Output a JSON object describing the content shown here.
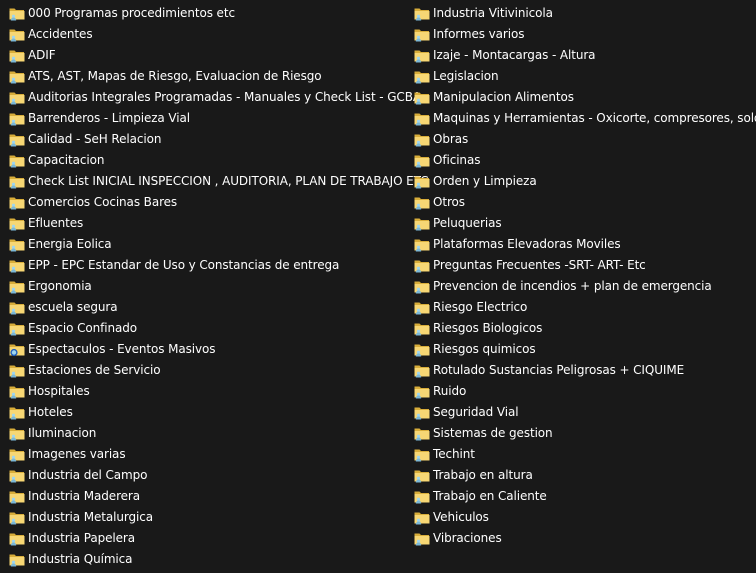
{
  "folder_icon": "folder-icon",
  "colors": {
    "background": "#191919",
    "text": "#ffffff",
    "folder": "#f7d774",
    "folder_dark": "#d8ad3a",
    "user_badge": "#9fd6ee"
  },
  "left_items": [
    {
      "label": "000 Programas procedimientos etc",
      "icon": "shared-folder-icon"
    },
    {
      "label": "Accidentes",
      "icon": "shared-folder-icon"
    },
    {
      "label": "ADIF",
      "icon": "shared-folder-icon"
    },
    {
      "label": "ATS, AST, Mapas de Riesgo, Evaluacion de Riesgo",
      "icon": "shared-folder-icon"
    },
    {
      "label": "Auditorias Integrales Programadas  - Manuales y Check List - GCBA",
      "icon": "shared-folder-icon"
    },
    {
      "label": "Barrenderos - Limpieza Vial",
      "icon": "shared-folder-icon"
    },
    {
      "label": "Calidad - SeH Relacion",
      "icon": "shared-folder-icon"
    },
    {
      "label": "Capacitacion",
      "icon": "shared-folder-icon"
    },
    {
      "label": "Check List INICIAL INSPECCION , AUDITORIA, PLAN DE TRABAJO  ETC",
      "icon": "shared-folder-icon"
    },
    {
      "label": "Comercios Cocinas Bares",
      "icon": "shared-folder-icon"
    },
    {
      "label": "Efluentes",
      "icon": "shared-folder-icon"
    },
    {
      "label": "Energia Eolica",
      "icon": "shared-folder-icon"
    },
    {
      "label": "EPP - EPC Estandar de Uso y Constancias de entrega",
      "icon": "shared-folder-icon"
    },
    {
      "label": "Ergonomia",
      "icon": "shared-folder-icon"
    },
    {
      "label": "escuela segura",
      "icon": "shared-folder-icon"
    },
    {
      "label": "Espacio Confinado",
      "icon": "shared-folder-icon"
    },
    {
      "label": "Espectaculos - Eventos Masivos",
      "icon": "sync-icon"
    },
    {
      "label": "Estaciones de Servicio",
      "icon": "shared-folder-icon"
    },
    {
      "label": "Hospitales",
      "icon": "shared-folder-icon"
    },
    {
      "label": "Hoteles",
      "icon": "shared-folder-icon"
    },
    {
      "label": "Iluminacion",
      "icon": "shared-folder-icon"
    },
    {
      "label": "Imagenes varias",
      "icon": "shared-folder-icon"
    },
    {
      "label": "Industria del Campo",
      "icon": "shared-folder-icon"
    },
    {
      "label": "Industria Maderera",
      "icon": "shared-folder-icon"
    },
    {
      "label": "Industria Metalurgica",
      "icon": "shared-folder-icon"
    },
    {
      "label": "Industria Papelera",
      "icon": "shared-folder-icon"
    },
    {
      "label": "Industria Química",
      "icon": "shared-folder-icon"
    }
  ],
  "right_items": [
    {
      "label": "Industria Vitivinicola",
      "icon": "shared-folder-icon"
    },
    {
      "label": "Informes varios",
      "icon": "shared-folder-icon"
    },
    {
      "label": "Izaje - Montacargas - Altura",
      "icon": "shared-folder-icon"
    },
    {
      "label": "Legislacion",
      "icon": "shared-folder-icon"
    },
    {
      "label": "Manipulacion Alimentos",
      "icon": "shared-folder-icon"
    },
    {
      "label": "Maquinas y Herramientas - Oxicorte, compresores, soldar",
      "icon": "shared-folder-icon"
    },
    {
      "label": "Obras",
      "icon": "shared-folder-icon"
    },
    {
      "label": "Oficinas",
      "icon": "shared-folder-icon"
    },
    {
      "label": "Orden y Limpieza",
      "icon": "shared-folder-icon"
    },
    {
      "label": "Otros",
      "icon": "shared-folder-icon"
    },
    {
      "label": "Peluquerias",
      "icon": "shared-folder-icon"
    },
    {
      "label": "Plataformas Elevadoras Moviles",
      "icon": "shared-folder-icon"
    },
    {
      "label": "Preguntas Frecuentes -SRT- ART- Etc",
      "icon": "shared-folder-icon"
    },
    {
      "label": "Prevencion de incendios + plan de emergencia",
      "icon": "shared-folder-icon"
    },
    {
      "label": "Riesgo Electrico",
      "icon": "shared-folder-icon"
    },
    {
      "label": "Riesgos Biologicos",
      "icon": "shared-folder-icon"
    },
    {
      "label": "Riesgos quimicos",
      "icon": "shared-folder-icon"
    },
    {
      "label": "Rotulado Sustancias Peligrosas + CIQUIME",
      "icon": "shared-folder-icon"
    },
    {
      "label": "Ruido",
      "icon": "shared-folder-icon"
    },
    {
      "label": "Seguridad Vial",
      "icon": "shared-folder-icon"
    },
    {
      "label": "Sistemas de gestion",
      "icon": "shared-folder-icon"
    },
    {
      "label": "Techint",
      "icon": "shared-folder-icon"
    },
    {
      "label": "Trabajo en altura",
      "icon": "shared-folder-icon"
    },
    {
      "label": "Trabajo en Caliente",
      "icon": "shared-folder-icon"
    },
    {
      "label": "Vehiculos",
      "icon": "shared-folder-icon"
    },
    {
      "label": "Vibraciones",
      "icon": "shared-folder-icon"
    }
  ]
}
